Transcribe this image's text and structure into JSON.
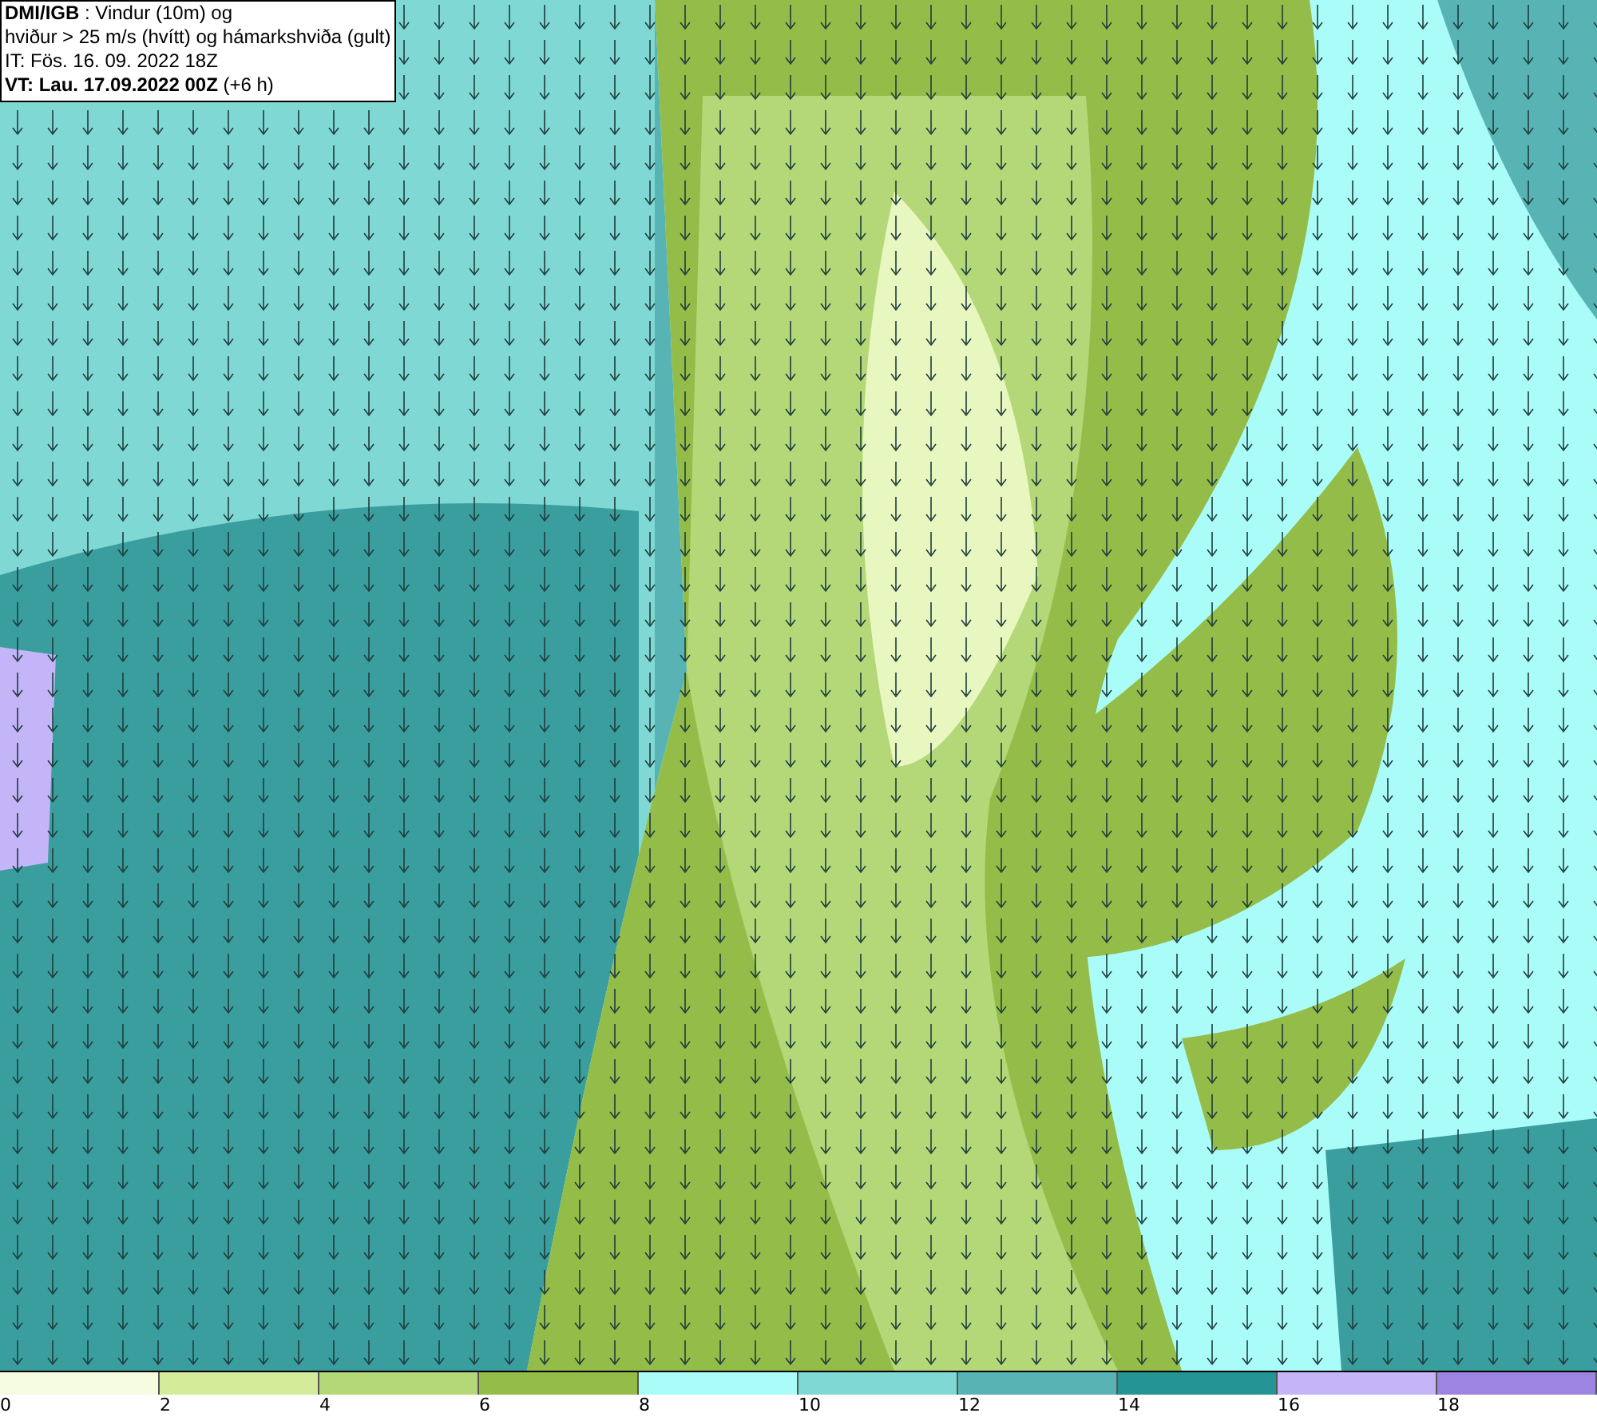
{
  "header": {
    "lines": [
      "**DMI/IGB** : Vindur (10m) og",
      "hviður > 25 m/s (hvítt) og hámarkshviða (gult)",
      "IT: Fös. 16. 09. 2022 18Z",
      "**VT: Lau. 17.09.2022 00Z** (+6 h)"
    ]
  },
  "legend": [
    {
      "label": "0",
      "color": "#f5fce0"
    },
    {
      "label": "2",
      "color": "#d4ec9a"
    },
    {
      "label": "4",
      "color": "#b4d878"
    },
    {
      "label": "6",
      "color": "#94bc48"
    },
    {
      "label": "8",
      "color": "#aafcf8"
    },
    {
      "label": "10",
      "color": "#80d8d4"
    },
    {
      "label": "12",
      "color": "#58b4b4"
    },
    {
      "label": "14",
      "color": "#259494"
    },
    {
      "label": "16",
      "color": "#c4b4f8"
    },
    {
      "label": "18",
      "color": "#9c84e0"
    }
  ]
}
